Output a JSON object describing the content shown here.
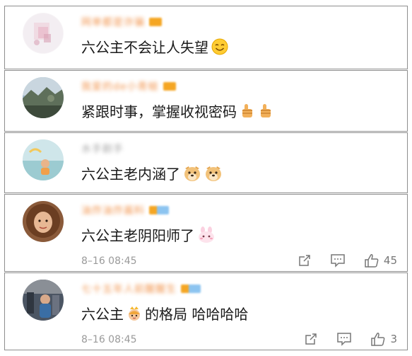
{
  "comments": [
    {
      "username": "网单都是诈骗",
      "text": "六公主不会让人失望",
      "avatar_icon": "avatar-pink-sketch",
      "emoji": [
        "smile-emoji"
      ]
    },
    {
      "username": "我爱的de小青蛙",
      "text": "紧跟时事，掌握收视密码",
      "avatar_icon": "avatar-landscape",
      "emoji": [
        "thumbs-up-emoji",
        "thumbs-up-emoji"
      ]
    },
    {
      "username": "水手剧手",
      "text": "六公主老内涵了",
      "avatar_icon": "avatar-sky-figure",
      "emoji": [
        "doge-emoji",
        "doge-emoji"
      ]
    },
    {
      "username": "油炸油炸酱料",
      "text": "六公主老阴阳师了",
      "avatar_icon": "avatar-curly-hair",
      "emoji": [
        "bunny-emoji"
      ],
      "time": "8–16 08:45",
      "likes": "45"
    },
    {
      "username": "七十五年人前醒醒生",
      "text_before": "六公主",
      "text_after": "的格局 哈哈哈哈",
      "avatar_icon": "avatar-street",
      "emoji": [
        "princess-emoji"
      ],
      "time": "8–16 08:45",
      "likes": "3"
    }
  ],
  "colors": {
    "username": "#f08a3c",
    "meta": "#9a9a9a",
    "border": "#8e8e8e"
  }
}
